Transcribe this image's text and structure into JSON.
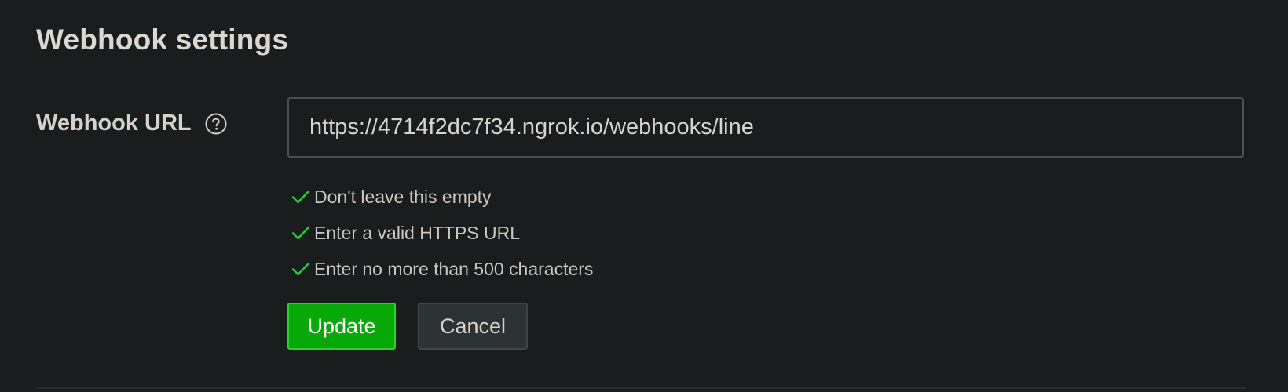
{
  "section": {
    "title": "Webhook settings"
  },
  "webhook_url": {
    "label": "Webhook URL",
    "value": "https://4714f2dc7f34.ngrok.io/webhooks/line",
    "help_icon": "question-circle-icon"
  },
  "validation": {
    "icon": "check-icon",
    "color": "#2bd12b",
    "rules": [
      "Don't leave this empty",
      "Enter a valid HTTPS URL",
      "Enter no more than 500 characters"
    ]
  },
  "actions": {
    "update_label": "Update",
    "cancel_label": "Cancel"
  },
  "colors": {
    "background": "#1a1d1e",
    "primary": "#06a906",
    "primary_border": "#2bd12b"
  }
}
